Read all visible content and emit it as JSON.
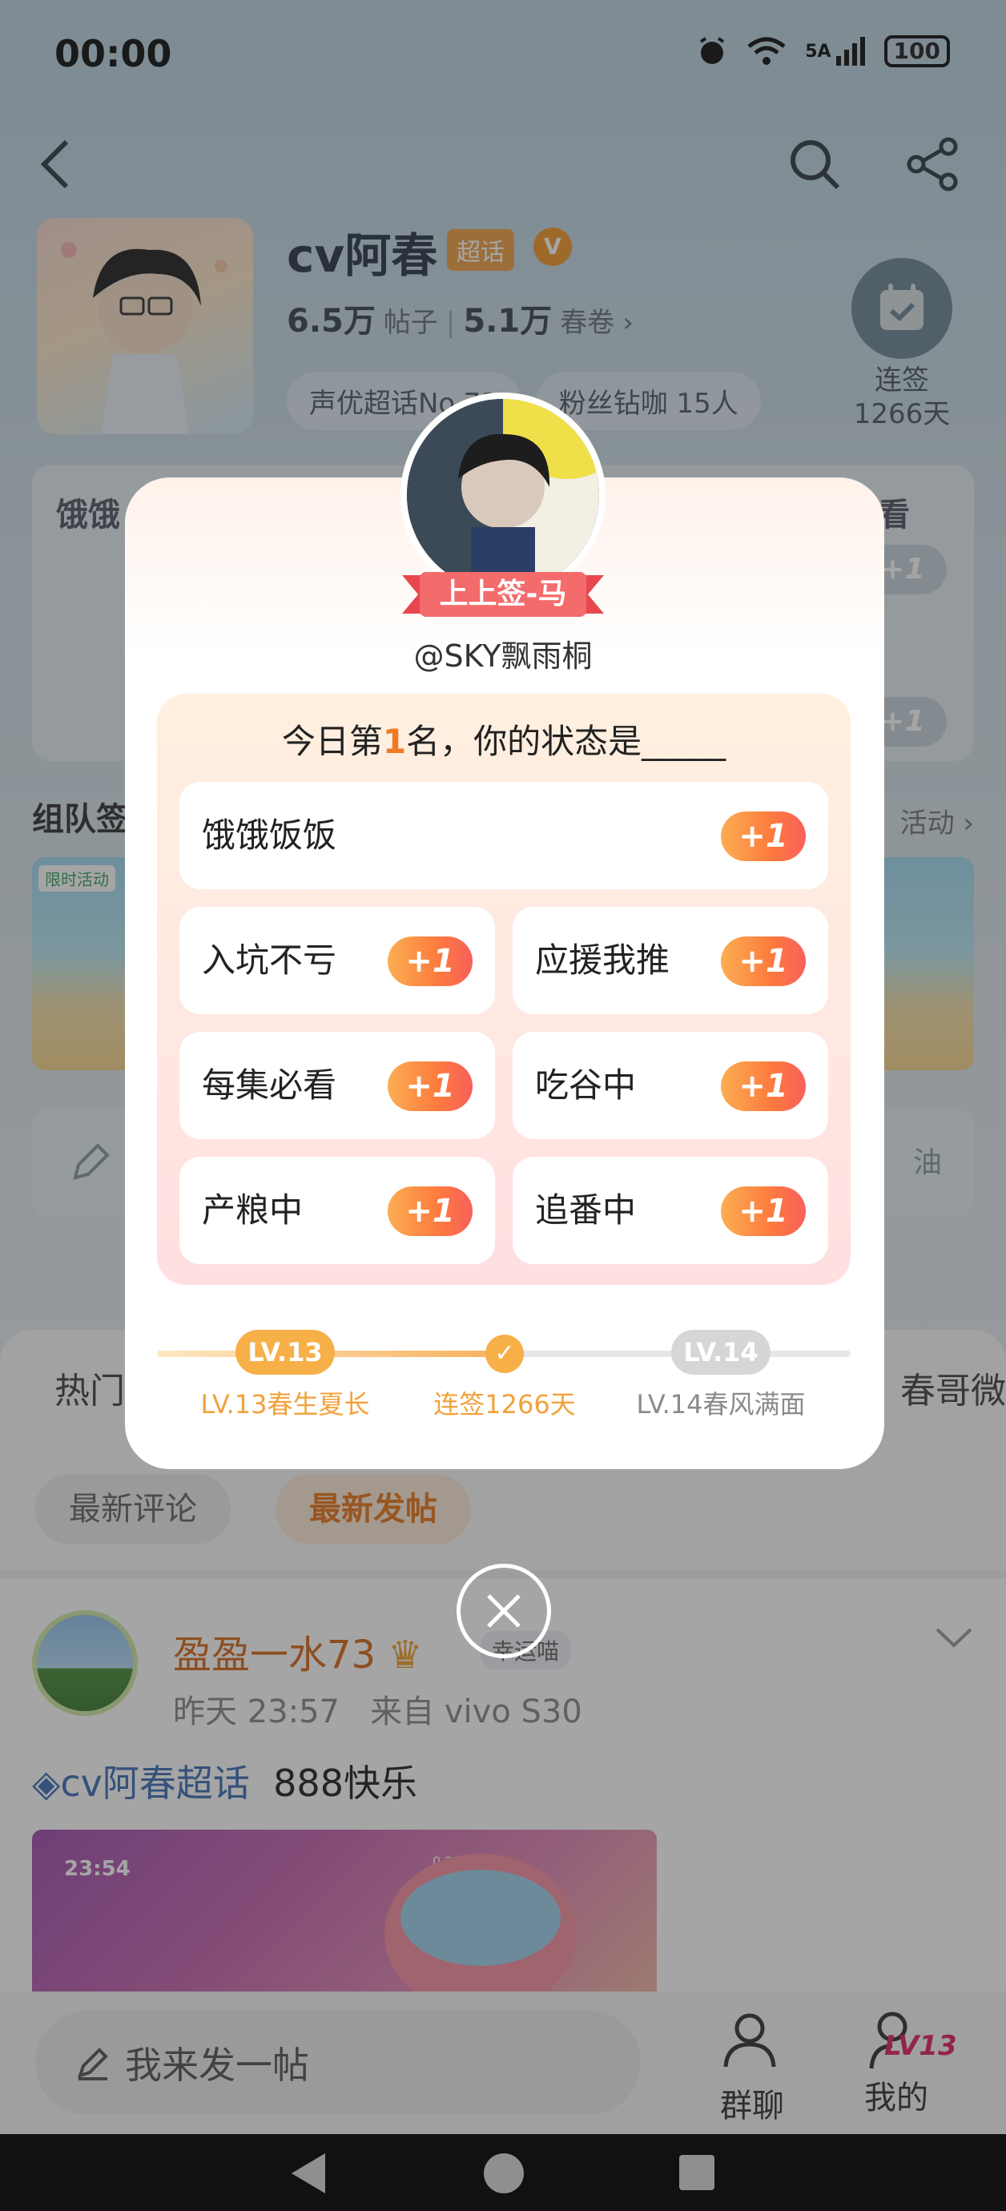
{
  "status_bar": {
    "time": "00:00",
    "network": "5A",
    "battery": "100"
  },
  "profile": {
    "name": "cv阿春",
    "super_tag": "超话",
    "v_badge": "V",
    "posts_count": "6.5万",
    "posts_label": "帖子",
    "juan_count": "5.1万",
    "juan_label": "春卷",
    "chip_rank": "声优超话No.73",
    "chip_fans": "粉丝钻咖 15人",
    "checkin_label": "连签",
    "checkin_days": "1266天"
  },
  "background": {
    "card_left_title": "饿饿",
    "card_right_title": "看",
    "card_plus": "+1",
    "team_title": "组队签",
    "team_more": "活动",
    "banner_tag": "限时活动",
    "bar_right": "油"
  },
  "tabs": {
    "hot": "热门",
    "right": "春哥微"
  },
  "sort": {
    "latest_comment": "最新评论",
    "latest_post": "最新发帖"
  },
  "post": {
    "author": "盈盈一水73",
    "badge": "幸运喵",
    "time": "昨天 23:57",
    "source": "来自 vivo S30",
    "topic": "cv阿春超话",
    "text": "888快乐",
    "image_time": "23:54",
    "image_speed": "0.20 KB/s"
  },
  "bottom": {
    "compose": "我来发一帖",
    "group_chat": "群聊",
    "mine": "我的",
    "mine_level": "LV13"
  },
  "modal": {
    "ribbon": "上上签-马",
    "handle": "@SKY飘雨桐",
    "question_prefix": "今日第",
    "question_num": "1",
    "question_suffix": "名，你的状态是_____",
    "plus_label": "+1",
    "options": [
      "饿饿饭饭",
      "入坑不亏",
      "应援我推",
      "每集必看",
      "吃谷中",
      "产粮中",
      "追番中"
    ],
    "level": {
      "current_pill": "LV.13",
      "current_caption": "LV.13春生夏长",
      "streak_caption": "连签1266天",
      "next_pill": "LV.14",
      "next_caption": "LV.14春风满面",
      "progress": 0.5
    }
  },
  "colors": {
    "accent": "#f07a23",
    "plus_gradient_start": "#fbae52",
    "plus_gradient_end": "#f8605c",
    "topic": "#3e6fb7"
  }
}
